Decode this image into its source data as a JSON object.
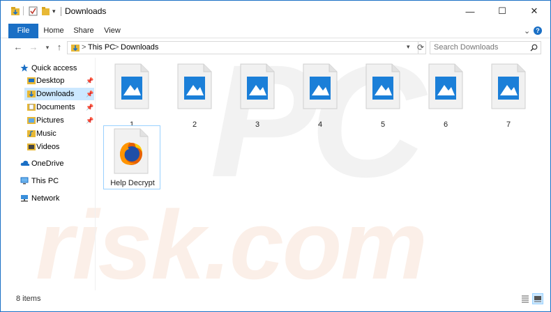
{
  "window": {
    "title": "Downloads",
    "controls": {
      "minimize": "—",
      "maximize": "☐",
      "close": "✕"
    }
  },
  "ribbon": {
    "tabs": [
      "File",
      "Home",
      "Share",
      "View"
    ]
  },
  "address": {
    "path": [
      "This PC",
      "Downloads"
    ],
    "separator": ">"
  },
  "search": {
    "placeholder": "Search Downloads"
  },
  "sidebar": {
    "items": [
      {
        "label": "Quick access",
        "icon": "star-icon"
      },
      {
        "label": "Desktop",
        "icon": "desktop-folder-icon",
        "pinned": true
      },
      {
        "label": "Downloads",
        "icon": "downloads-folder-icon",
        "pinned": true,
        "selected": true
      },
      {
        "label": "Documents",
        "icon": "documents-folder-icon",
        "pinned": true
      },
      {
        "label": "Pictures",
        "icon": "pictures-folder-icon",
        "pinned": true
      },
      {
        "label": "Music",
        "icon": "music-folder-icon"
      },
      {
        "label": "Videos",
        "icon": "videos-folder-icon"
      },
      {
        "label": "OneDrive",
        "icon": "cloud-icon"
      },
      {
        "label": "This PC",
        "icon": "computer-icon"
      },
      {
        "label": "Network",
        "icon": "network-icon"
      }
    ]
  },
  "files": [
    {
      "name": "1",
      "type": "image"
    },
    {
      "name": "2",
      "type": "image"
    },
    {
      "name": "3",
      "type": "image"
    },
    {
      "name": "4",
      "type": "image"
    },
    {
      "name": "5",
      "type": "image"
    },
    {
      "name": "6",
      "type": "image"
    },
    {
      "name": "7",
      "type": "image"
    },
    {
      "name": "Help Decrypt",
      "type": "firefox-html",
      "selected": true
    }
  ],
  "status": {
    "item_count": "8 items"
  },
  "colors": {
    "accent": "#1a6fc5",
    "selection": "#cce8ff",
    "image_blue": "#1b7fd8"
  },
  "watermark": {
    "line1": "PC",
    "line2": "risk.com"
  }
}
